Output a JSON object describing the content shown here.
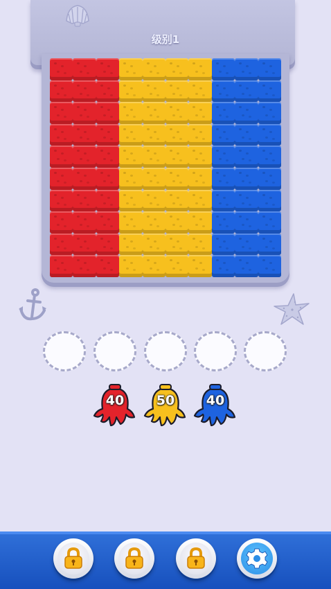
{
  "header": {
    "level_label": "级别1",
    "shell_icon": "scallop-shell-icon"
  },
  "board": {
    "rows": 10,
    "columns": [
      "red",
      "red",
      "red",
      "yellow",
      "yellow",
      "yellow",
      "yellow",
      "blue",
      "blue",
      "blue"
    ],
    "colors": {
      "red": "#e3232b",
      "yellow": "#f7c01e",
      "blue": "#1e63e0"
    }
  },
  "decorations": {
    "left": "anchor-icon",
    "right": "starfish-icon"
  },
  "slots": {
    "count": 5
  },
  "counters": [
    {
      "color": "red",
      "hex": "#e3232b",
      "value": "40"
    },
    {
      "color": "yellow",
      "hex": "#f7c01e",
      "value": "50"
    },
    {
      "color": "blue",
      "hex": "#1e63e0",
      "value": "40"
    }
  ],
  "toolbar": {
    "buttons": [
      {
        "icon": "lock-icon",
        "state": "locked"
      },
      {
        "icon": "lock-icon",
        "state": "locked"
      },
      {
        "icon": "lock-icon",
        "state": "locked"
      },
      {
        "icon": "gear-icon",
        "state": "settings"
      }
    ]
  }
}
